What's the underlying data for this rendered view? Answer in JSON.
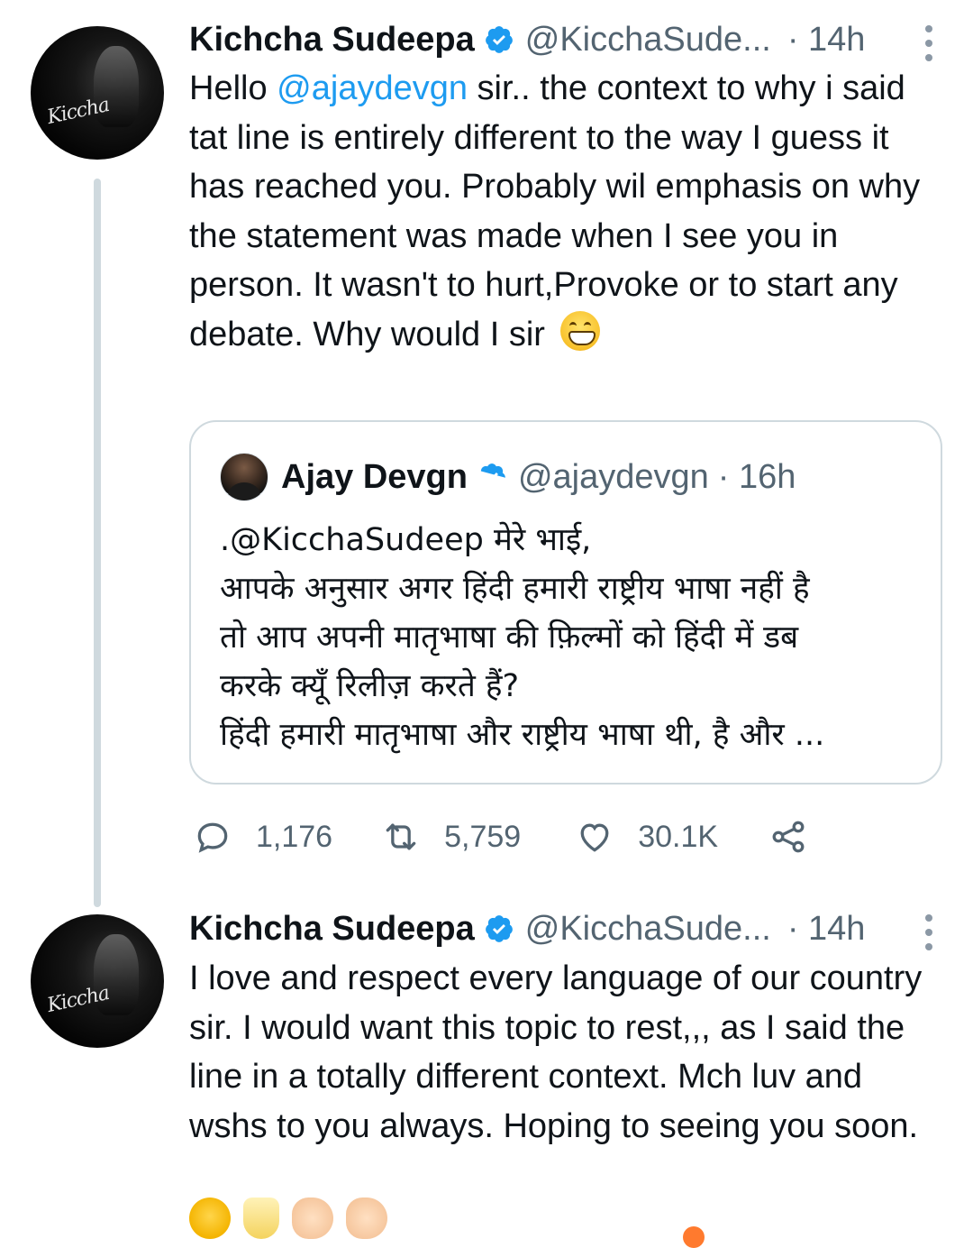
{
  "tweets": [
    {
      "author_name": "Kichcha Sudeepa",
      "handle": "@KicchaSude...",
      "time": "· 14h",
      "avatar_signature": "Kiccha",
      "text_lines": [
        "Hello",
        "@ajaydevgn",
        " sir.. the context to why i said tat line is entirely different to the way I guess it has reached you. Probably wil emphasis on why the statement was made when I see you in person. It wasn't to hurt,Provoke or to start any debate. Why would I sir"
      ],
      "emoji": "grinning-face-with-smiling-eyes"
    },
    {
      "author_name": "Kichcha Sudeepa",
      "handle": "@KicchaSude...",
      "time": "· 14h",
      "avatar_signature": "Kiccha",
      "text": "I love and respect every language of our country sir. I would want this topic to rest,,, as I said the line in a totally different context. Mch luv and wshs to you always. Hoping to seeing you soon.",
      "emojis": [
        "partying-face",
        "clinking-glasses",
        "left-facing-fist",
        "right-facing-fist"
      ]
    }
  ],
  "quoted_tweet": {
    "author_name": "Ajay Devgn",
    "handle": "@ajaydevgn",
    "time": "· 16h",
    "lines": [
      ".@KicchaSudeep मेरे भाई,",
      "आपके अनुसार अगर हिंदी हमारी राष्ट्रीय भाषा नहीं है",
      "तो आप अपनी मातृभाषा की फ़िल्मों को हिंदी में डब",
      "करके क्यूँ रिलीज़ करते हैं?",
      "हिंदी हमारी मातृभाषा और राष्ट्रीय भाषा थी, है और ..."
    ]
  },
  "actions": {
    "replies": "1,176",
    "retweets": "5,759",
    "likes": "30.1K"
  },
  "colors": {
    "link": "#1d9bf0",
    "verified": "#1d9bf0",
    "secondary_text": "#536471",
    "border": "#cfd9de"
  },
  "icons": [
    "more-icon",
    "verified-badge-icon",
    "reply-icon",
    "retweet-icon",
    "like-icon",
    "share-icon"
  ]
}
